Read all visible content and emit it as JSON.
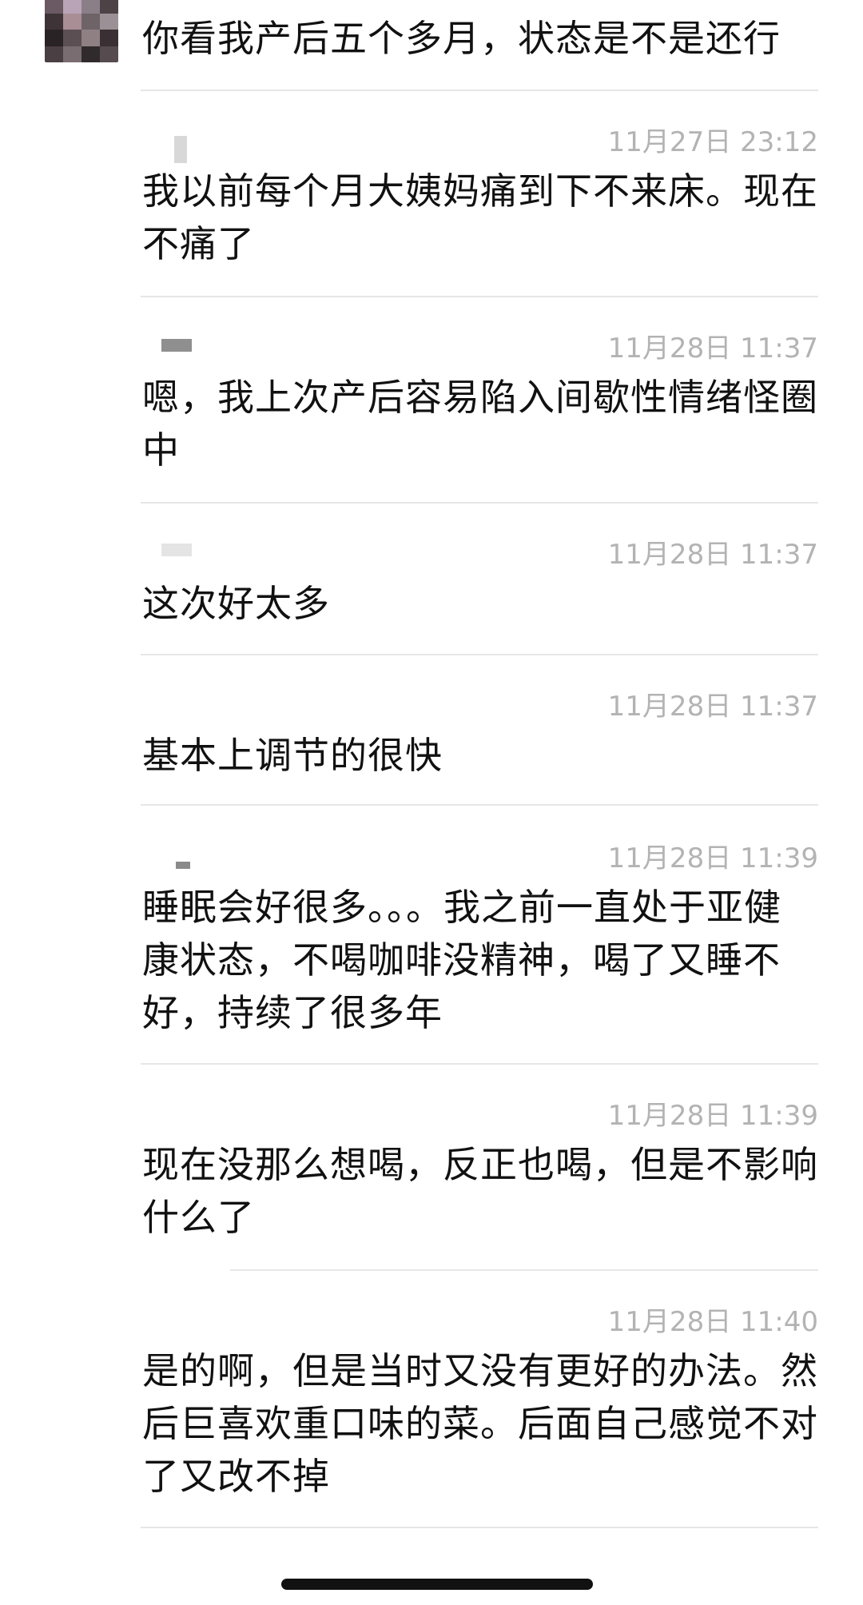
{
  "messages": [
    {
      "id": "m0",
      "text": "你看我产后五个多月，状态是不是还行"
    },
    {
      "id": "m1",
      "time": "11月27日 23:12",
      "text": "我以前每个月大姨妈痛到下不来床。现在不痛了"
    },
    {
      "id": "m2",
      "time": "11月28日 11:37",
      "text": "嗯，我上次产后容易陷入间歇性情绪怪圈中"
    },
    {
      "id": "m3",
      "time": "11月28日 11:37",
      "text": "这次好太多"
    },
    {
      "id": "m4",
      "time": "11月28日 11:37",
      "text": "基本上调节的很快"
    },
    {
      "id": "m5",
      "time": "11月28日 11:39",
      "text": "睡眠会好很多。。。我之前一直处于亚健康状态，不喝咖啡没精神，喝了又睡不好，持续了很多年"
    },
    {
      "id": "m6",
      "time": "11月28日 11:39",
      "text": "现在没那么想喝，反正也喝，但是不影响什么了"
    },
    {
      "id": "m7",
      "time": "11月28日 11:40",
      "text": "是的啊，但是当时又没有更好的办法。然后巨喜欢重口味的菜。后面自己感觉不对了又改不掉"
    }
  ],
  "avatar": {
    "icon": "blurred-avatar-icon",
    "colors": [
      "#6b5a63",
      "#b9a3b6",
      "#8a7f86",
      "#4d4246",
      "#3e3438",
      "#a98e95",
      "#6e6468",
      "#9a9095",
      "#2a2326",
      "#5b4f53",
      "#8f8084",
      "#3a3033",
      "#4a3f43",
      "#7a6d71",
      "#312a2d",
      "#564b4f"
    ]
  },
  "colors": {
    "text": "#111111",
    "timestamp": "#b3b3b3",
    "divider": "#e6e6e6",
    "background": "#ffffff"
  }
}
